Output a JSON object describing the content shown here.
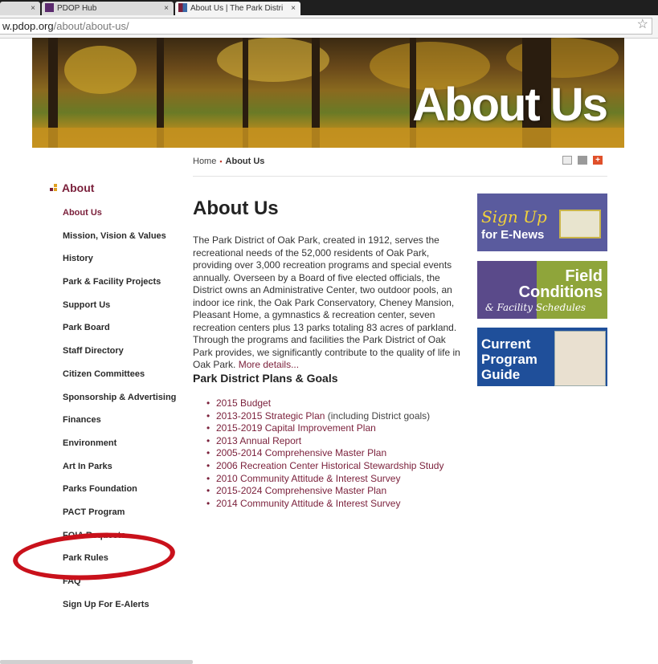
{
  "browser": {
    "tabs": [
      {
        "label": "PDOP Hub",
        "close": "×"
      },
      {
        "label": "About Us | The Park Distri",
        "close": "×"
      }
    ],
    "url_host": "w.pdop.org",
    "url_path": "/about/about-us/"
  },
  "banner": {
    "title": "About Us"
  },
  "breadcrumb": {
    "home": "Home",
    "separator": "▪",
    "current": "About Us"
  },
  "sidebar": {
    "heading": "About",
    "items": [
      {
        "label": "About Us"
      },
      {
        "label": "Mission, Vision & Values"
      },
      {
        "label": "History"
      },
      {
        "label": "Park & Facility Projects"
      },
      {
        "label": "Support Us"
      },
      {
        "label": "Park Board"
      },
      {
        "label": "Staff Directory"
      },
      {
        "label": "Citizen Committees"
      },
      {
        "label": "Sponsorship & Advertising"
      },
      {
        "label": "Finances"
      },
      {
        "label": "Environment"
      },
      {
        "label": "Art In Parks"
      },
      {
        "label": "Parks Foundation"
      },
      {
        "label": "PACT Program"
      },
      {
        "label": "FOIA Requests"
      },
      {
        "label": "Park Rules"
      },
      {
        "label": "FAQ"
      },
      {
        "label": "Sign Up For E-Alerts"
      }
    ]
  },
  "main": {
    "title": "About Us",
    "intro": "The Park District of Oak Park, created in 1912, serves the recreational needs of the 52,000 residents of Oak Park, providing over 3,000 recreation programs and special events annually. Overseen by a Board of five elected officials, the District owns an Administrative Center, two outdoor pools, an indoor ice rink, the Oak Park Conservatory, Cheney Mansion, Pleasant Home, a gymnastics & recreation center, seven recreation centers plus 13 parks totaling 83 acres of parkland. Through the programs and facilities the Park District of Oak Park provides, we significantly contribute to the quality of life in Oak Park.",
    "more_link": "More details...",
    "plans_title": "Park District Plans & Goals",
    "plans": [
      {
        "label": "2015 Budget",
        "note": ""
      },
      {
        "label": "2013-2015 Strategic Plan",
        "note": " (including District goals)"
      },
      {
        "label": "2015-2019 Capital Improvement Plan",
        "note": ""
      },
      {
        "label": "2013 Annual Report",
        "note": ""
      },
      {
        "label": "2005-2014 Comprehensive Master Plan",
        "note": ""
      },
      {
        "label": "2006 Recreation Center Historical Stewardship Study",
        "note": ""
      },
      {
        "label": "2010 Community Attitude & Interest Survey",
        "note": ""
      },
      {
        "label": "2015-2024 Comprehensive Master Plan",
        "note": ""
      },
      {
        "label": "2014 Community Attitude & Interest Survey",
        "note": ""
      }
    ]
  },
  "promos": {
    "enews": {
      "line1": "Sign Up",
      "line2": "for E-News"
    },
    "field": {
      "line1": "Field",
      "line2": "Conditions",
      "line3": "& Facility Schedules"
    },
    "guide": {
      "line1": "Current",
      "line2": "Program",
      "line3": "Guide"
    }
  },
  "colors": {
    "accent": "#7a1f3a",
    "highlight_oval": "#c9111b"
  }
}
